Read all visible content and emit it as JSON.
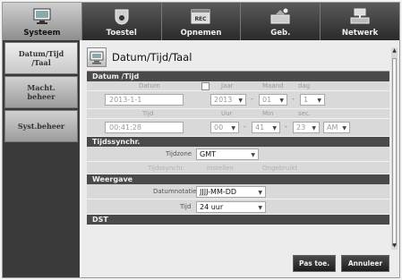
{
  "tabs": [
    {
      "label": "Systeem",
      "icon": "monitor-icon",
      "active": true
    },
    {
      "label": "Toestel",
      "icon": "camera-icon",
      "active": false
    },
    {
      "label": "Opnemen",
      "icon": "rec-icon",
      "active": false
    },
    {
      "label": "Geb.",
      "icon": "event-icon",
      "active": false
    },
    {
      "label": "Netwerk",
      "icon": "network-icon",
      "active": false
    }
  ],
  "sidebar": {
    "items": [
      {
        "label_line1": "Datum/Tijd",
        "label_line2": "/Taal"
      },
      {
        "label_line1": "Macht.",
        "label_line2": "beheer"
      },
      {
        "label_line1": "Syst.beheer",
        "label_line2": ""
      }
    ]
  },
  "page": {
    "title": "Datum/Tijd/Taal"
  },
  "datetime": {
    "section": "Datum /Tijd",
    "date_label": "Datum",
    "date_value": "2013-1-1",
    "year_label": "Jaar",
    "month_label": "Maand",
    "day_label": "dag",
    "year_value": "2013",
    "month_value": "01",
    "day_value": "1",
    "time_label": "Tijd",
    "time_value": "00:41:28",
    "hour_label": "Uur",
    "min_label": "Min",
    "sec_label": "sec.",
    "hour_value": "00",
    "min_value": "41",
    "sec_value": "23",
    "ampm_value": "AM"
  },
  "sync": {
    "section": "Tijdssynchr.",
    "timezone_label": "Tijdzone",
    "timezone_value": "GMT",
    "sync_label": "Tijdssynchr.",
    "setup_label": "Instellen",
    "unused_label": "Ongebruikt"
  },
  "display": {
    "section": "Weergave",
    "dateformat_label": "Datumnotatie",
    "dateformat_value": "JJJJ-MM-DD",
    "time_label": "Tijd",
    "time_value": "24 uur",
    "dst_label": "DST"
  },
  "buttons": {
    "apply": "Pas toe.",
    "cancel": "Annuleer"
  },
  "dash": "-",
  "arrow": "▼",
  "colors": {
    "accent_dark": "#2a2a2a",
    "section": "#4a4a4a",
    "row_bg": "#d9d9d9"
  }
}
